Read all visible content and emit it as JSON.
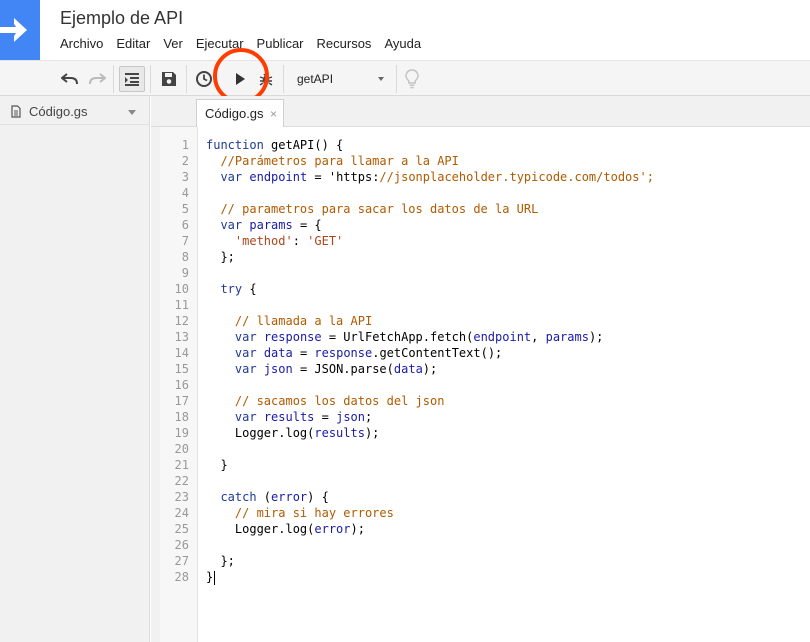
{
  "app": {
    "title": "Ejemplo de API",
    "brand_color": "#4285f4",
    "highlight_color": "#ff3d00"
  },
  "menu": [
    {
      "label": "Archivo"
    },
    {
      "label": "Editar"
    },
    {
      "label": "Ver"
    },
    {
      "label": "Ejecutar"
    },
    {
      "label": "Publicar"
    },
    {
      "label": "Recursos"
    },
    {
      "label": "Ayuda"
    }
  ],
  "toolbar": {
    "undo_icon": "undo-icon",
    "redo_icon": "redo-icon",
    "indent_icon": "format-indent-icon",
    "save_icon": "save-icon",
    "triggers_icon": "clock-icon",
    "run_icon": "play-icon",
    "debug_icon": "bug-icon",
    "function_select": "getAPI",
    "lightbulb_icon": "lightbulb-icon"
  },
  "files": [
    {
      "name": "Código.gs",
      "icon": "file-icon"
    }
  ],
  "tabs": [
    {
      "label": "Código.gs",
      "close": "×"
    }
  ],
  "editor": {
    "lines": [
      {
        "n": "1",
        "text": "function getAPI() {"
      },
      {
        "n": "2",
        "text": "  //Parámetros para llamar a la API"
      },
      {
        "n": "3",
        "text": "  var endpoint = 'https://jsonplaceholder.typicode.com/todos';"
      },
      {
        "n": "4",
        "text": ""
      },
      {
        "n": "5",
        "text": "  // parametros para sacar los datos de la URL"
      },
      {
        "n": "6",
        "text": "  var params = {"
      },
      {
        "n": "7",
        "text": "    'method': 'GET'"
      },
      {
        "n": "8",
        "text": "  };"
      },
      {
        "n": "9",
        "text": ""
      },
      {
        "n": "10",
        "text": "  try {"
      },
      {
        "n": "11",
        "text": ""
      },
      {
        "n": "12",
        "text": "    // llamada a la API"
      },
      {
        "n": "13",
        "text": "    var response = UrlFetchApp.fetch(endpoint, params);"
      },
      {
        "n": "14",
        "text": "    var data = response.getContentText();"
      },
      {
        "n": "15",
        "text": "    var json = JSON.parse(data);"
      },
      {
        "n": "16",
        "text": ""
      },
      {
        "n": "17",
        "text": "    // sacamos los datos del json"
      },
      {
        "n": "18",
        "text": "    var results = json;"
      },
      {
        "n": "19",
        "text": "    Logger.log(results);"
      },
      {
        "n": "20",
        "text": ""
      },
      {
        "n": "21",
        "text": "  }"
      },
      {
        "n": "22",
        "text": ""
      },
      {
        "n": "23",
        "text": "  catch (error) {"
      },
      {
        "n": "24",
        "text": "    // mira si hay errores"
      },
      {
        "n": "25",
        "text": "    Logger.log(error);"
      },
      {
        "n": "26",
        "text": ""
      },
      {
        "n": "27",
        "text": "  };"
      },
      {
        "n": "28",
        "text": "}"
      }
    ]
  }
}
